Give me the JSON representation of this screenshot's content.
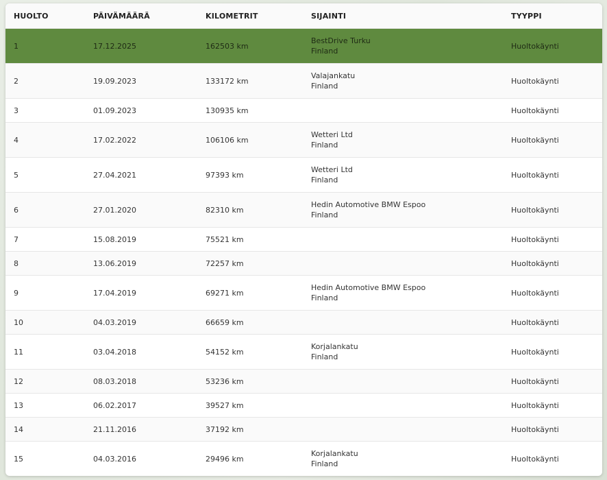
{
  "table": {
    "headers": [
      "HUOLTO",
      "PÄIVÄMÄÄRÄ",
      "KILOMETRIT",
      "SIJAINTI",
      "TYYPPI"
    ],
    "active_row": 0,
    "accent_color": "#5f8a3f",
    "rows": [
      {
        "n": "1",
        "date": "17.12.2025",
        "km": "162503 km",
        "loc1": "BestDrive Turku",
        "loc2": "Finland",
        "type": "Huoltokäynti"
      },
      {
        "n": "2",
        "date": "19.09.2023",
        "km": "133172 km",
        "loc1": "Valajankatu",
        "loc2": "Finland",
        "type": "Huoltokäynti"
      },
      {
        "n": "3",
        "date": "01.09.2023",
        "km": "130935 km",
        "loc1": "",
        "loc2": "",
        "type": "Huoltokäynti"
      },
      {
        "n": "4",
        "date": "17.02.2022",
        "km": "106106 km",
        "loc1": "Wetteri Ltd",
        "loc2": "Finland",
        "type": "Huoltokäynti"
      },
      {
        "n": "5",
        "date": "27.04.2021",
        "km": "97393 km",
        "loc1": "Wetteri Ltd",
        "loc2": "Finland",
        "type": "Huoltokäynti"
      },
      {
        "n": "6",
        "date": "27.01.2020",
        "km": "82310 km",
        "loc1": "Hedin Automotive BMW Espoo",
        "loc2": "Finland",
        "type": "Huoltokäynti"
      },
      {
        "n": "7",
        "date": "15.08.2019",
        "km": "75521 km",
        "loc1": "",
        "loc2": "",
        "type": "Huoltokäynti"
      },
      {
        "n": "8",
        "date": "13.06.2019",
        "km": "72257 km",
        "loc1": "",
        "loc2": "",
        "type": "Huoltokäynti"
      },
      {
        "n": "9",
        "date": "17.04.2019",
        "km": "69271 km",
        "loc1": "Hedin Automotive BMW Espoo",
        "loc2": "Finland",
        "type": "Huoltokäynti"
      },
      {
        "n": "10",
        "date": "04.03.2019",
        "km": "66659 km",
        "loc1": "",
        "loc2": "",
        "type": "Huoltokäynti"
      },
      {
        "n": "11",
        "date": "03.04.2018",
        "km": "54152 km",
        "loc1": "Korjalankatu",
        "loc2": "Finland",
        "type": "Huoltokäynti"
      },
      {
        "n": "12",
        "date": "08.03.2018",
        "km": "53236 km",
        "loc1": "",
        "loc2": "",
        "type": "Huoltokäynti"
      },
      {
        "n": "13",
        "date": "06.02.2017",
        "km": "39527 km",
        "loc1": "",
        "loc2": "",
        "type": "Huoltokäynti"
      },
      {
        "n": "14",
        "date": "21.11.2016",
        "km": "37192 km",
        "loc1": "",
        "loc2": "",
        "type": "Huoltokäynti"
      },
      {
        "n": "15",
        "date": "04.03.2016",
        "km": "29496 km",
        "loc1": "Korjalankatu",
        "loc2": "Finland",
        "type": "Huoltokäynti"
      }
    ]
  }
}
